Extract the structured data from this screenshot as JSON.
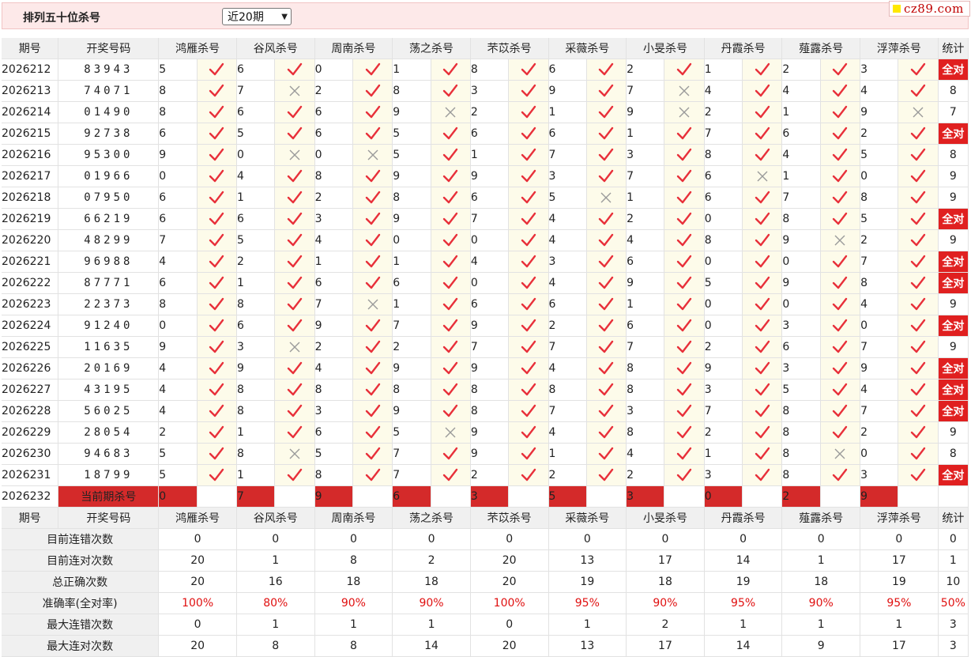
{
  "header": {
    "title": "排列五十位杀号",
    "period_select": "近20期",
    "logo": "cz89.com"
  },
  "table": {
    "col_issue": "期号",
    "col_draw": "开奖号码",
    "col_stat": "统计",
    "experts": [
      "鸿雁杀号",
      "谷风杀号",
      "周南杀号",
      "荡之杀号",
      "芣苡杀号",
      "采薇杀号",
      "小旻杀号",
      "丹霞杀号",
      "薤露杀号",
      "浮萍杀号"
    ],
    "full_label": "全对",
    "rows": [
      {
        "issue": "2026212",
        "draw": "83943",
        "kills": [
          5,
          6,
          0,
          1,
          8,
          6,
          2,
          1,
          2,
          3
        ],
        "marks": [
          1,
          1,
          1,
          1,
          1,
          1,
          1,
          1,
          1,
          1
        ],
        "stat": "全对"
      },
      {
        "issue": "2026213",
        "draw": "74071",
        "kills": [
          8,
          7,
          2,
          8,
          3,
          9,
          7,
          4,
          4,
          4
        ],
        "marks": [
          1,
          0,
          1,
          1,
          1,
          1,
          0,
          1,
          1,
          1
        ],
        "stat": "8"
      },
      {
        "issue": "2026214",
        "draw": "01490",
        "kills": [
          8,
          6,
          6,
          9,
          2,
          1,
          9,
          2,
          1,
          9
        ],
        "marks": [
          1,
          1,
          1,
          0,
          1,
          1,
          0,
          1,
          1,
          0
        ],
        "stat": "7"
      },
      {
        "issue": "2026215",
        "draw": "92738",
        "kills": [
          6,
          5,
          6,
          5,
          6,
          6,
          1,
          7,
          6,
          2
        ],
        "marks": [
          1,
          1,
          1,
          1,
          1,
          1,
          1,
          1,
          1,
          1
        ],
        "stat": "全对"
      },
      {
        "issue": "2026216",
        "draw": "95300",
        "kills": [
          9,
          0,
          0,
          5,
          1,
          7,
          3,
          8,
          4,
          5
        ],
        "marks": [
          1,
          0,
          0,
          1,
          1,
          1,
          1,
          1,
          1,
          1
        ],
        "stat": "8"
      },
      {
        "issue": "2026217",
        "draw": "01966",
        "kills": [
          0,
          4,
          8,
          9,
          9,
          3,
          7,
          6,
          1,
          0
        ],
        "marks": [
          1,
          1,
          1,
          1,
          1,
          1,
          1,
          0,
          1,
          1
        ],
        "stat": "9"
      },
      {
        "issue": "2026218",
        "draw": "07950",
        "kills": [
          6,
          1,
          2,
          8,
          6,
          5,
          1,
          6,
          7,
          8
        ],
        "marks": [
          1,
          1,
          1,
          1,
          1,
          0,
          1,
          1,
          1,
          1
        ],
        "stat": "9"
      },
      {
        "issue": "2026219",
        "draw": "66219",
        "kills": [
          6,
          6,
          3,
          9,
          7,
          4,
          2,
          0,
          8,
          5
        ],
        "marks": [
          1,
          1,
          1,
          1,
          1,
          1,
          1,
          1,
          1,
          1
        ],
        "stat": "全对"
      },
      {
        "issue": "2026220",
        "draw": "48299",
        "kills": [
          7,
          5,
          4,
          0,
          0,
          4,
          4,
          8,
          9,
          2
        ],
        "marks": [
          1,
          1,
          1,
          1,
          1,
          1,
          1,
          1,
          0,
          1
        ],
        "stat": "9"
      },
      {
        "issue": "2026221",
        "draw": "96988",
        "kills": [
          4,
          2,
          1,
          1,
          4,
          3,
          6,
          0,
          0,
          7
        ],
        "marks": [
          1,
          1,
          1,
          1,
          1,
          1,
          1,
          1,
          1,
          1
        ],
        "stat": "全对"
      },
      {
        "issue": "2026222",
        "draw": "87771",
        "kills": [
          6,
          1,
          6,
          6,
          0,
          4,
          9,
          5,
          9,
          8
        ],
        "marks": [
          1,
          1,
          1,
          1,
          1,
          1,
          1,
          1,
          1,
          1
        ],
        "stat": "全对"
      },
      {
        "issue": "2026223",
        "draw": "22373",
        "kills": [
          8,
          8,
          7,
          1,
          6,
          6,
          1,
          0,
          0,
          4
        ],
        "marks": [
          1,
          1,
          0,
          1,
          1,
          1,
          1,
          1,
          1,
          1
        ],
        "stat": "9"
      },
      {
        "issue": "2026224",
        "draw": "91240",
        "kills": [
          0,
          6,
          9,
          7,
          9,
          2,
          6,
          0,
          3,
          0
        ],
        "marks": [
          1,
          1,
          1,
          1,
          1,
          1,
          1,
          1,
          1,
          1
        ],
        "stat": "全对"
      },
      {
        "issue": "2026225",
        "draw": "11635",
        "kills": [
          9,
          3,
          2,
          2,
          7,
          7,
          7,
          2,
          6,
          7
        ],
        "marks": [
          1,
          0,
          1,
          1,
          1,
          1,
          1,
          1,
          1,
          1
        ],
        "stat": "9"
      },
      {
        "issue": "2026226",
        "draw": "20169",
        "kills": [
          4,
          9,
          4,
          9,
          9,
          4,
          8,
          9,
          3,
          9
        ],
        "marks": [
          1,
          1,
          1,
          1,
          1,
          1,
          1,
          1,
          1,
          1
        ],
        "stat": "全对"
      },
      {
        "issue": "2026227",
        "draw": "43195",
        "kills": [
          4,
          8,
          8,
          8,
          8,
          8,
          8,
          3,
          5,
          4
        ],
        "marks": [
          1,
          1,
          1,
          1,
          1,
          1,
          1,
          1,
          1,
          1
        ],
        "stat": "全对"
      },
      {
        "issue": "2026228",
        "draw": "56025",
        "kills": [
          4,
          8,
          3,
          9,
          8,
          7,
          3,
          7,
          8,
          7
        ],
        "marks": [
          1,
          1,
          1,
          1,
          1,
          1,
          1,
          1,
          1,
          1
        ],
        "stat": "全对"
      },
      {
        "issue": "2026229",
        "draw": "28054",
        "kills": [
          2,
          1,
          6,
          5,
          9,
          4,
          8,
          2,
          8,
          2
        ],
        "marks": [
          1,
          1,
          1,
          0,
          1,
          1,
          1,
          1,
          1,
          1
        ],
        "stat": "9"
      },
      {
        "issue": "2026230",
        "draw": "94683",
        "kills": [
          5,
          8,
          5,
          7,
          9,
          1,
          4,
          1,
          8,
          0
        ],
        "marks": [
          1,
          0,
          1,
          1,
          1,
          1,
          1,
          1,
          0,
          1
        ],
        "stat": "8"
      },
      {
        "issue": "2026231",
        "draw": "18799",
        "kills": [
          5,
          1,
          8,
          7,
          2,
          2,
          2,
          3,
          8,
          3
        ],
        "marks": [
          1,
          1,
          1,
          1,
          1,
          1,
          1,
          1,
          1,
          1
        ],
        "stat": "全对"
      }
    ],
    "current": {
      "issue": "2026232",
      "label": "当前期杀号",
      "kills": [
        0,
        7,
        9,
        6,
        3,
        5,
        3,
        0,
        2,
        9
      ]
    },
    "summary": [
      {
        "label": "目前连错次数",
        "values": [
          "0",
          "0",
          "0",
          "0",
          "0",
          "0",
          "0",
          "0",
          "0",
          "0",
          "0"
        ],
        "rate": false
      },
      {
        "label": "目前连对次数",
        "values": [
          "20",
          "1",
          "8",
          "2",
          "20",
          "13",
          "17",
          "14",
          "1",
          "17",
          "1"
        ],
        "rate": false
      },
      {
        "label": "总正确次数",
        "values": [
          "20",
          "16",
          "18",
          "18",
          "20",
          "19",
          "18",
          "19",
          "18",
          "19",
          "10"
        ],
        "rate": false
      },
      {
        "label": "准确率(全对率)",
        "values": [
          "100%",
          "80%",
          "90%",
          "90%",
          "100%",
          "95%",
          "90%",
          "95%",
          "90%",
          "95%",
          "50%"
        ],
        "rate": true
      },
      {
        "label": "最大连错次数",
        "values": [
          "0",
          "1",
          "1",
          "1",
          "0",
          "1",
          "2",
          "1",
          "1",
          "1",
          "3"
        ],
        "rate": false
      },
      {
        "label": "最大连对次数",
        "values": [
          "20",
          "8",
          "8",
          "14",
          "20",
          "13",
          "17",
          "14",
          "9",
          "17",
          "3"
        ],
        "rate": false
      }
    ]
  },
  "colors": {
    "check": "#e8303a",
    "cross": "#9a9a9a",
    "accent_red": "#d42a2a",
    "summary_blue": "#1a1ac8"
  }
}
